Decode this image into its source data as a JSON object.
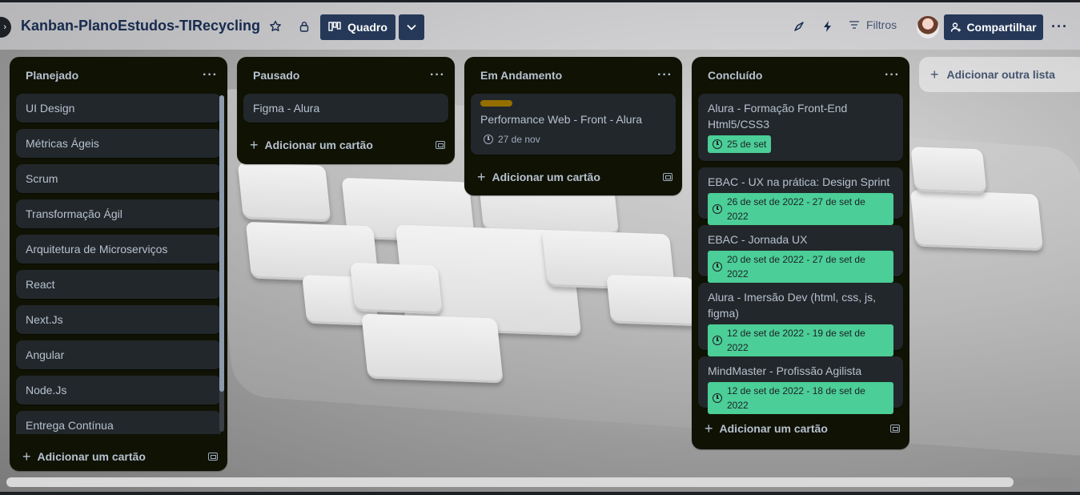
{
  "header": {
    "board_title": "Kanban-PlanoEstudos-TIRecycling",
    "view_label": "Quadro",
    "filters_label": "Filtros",
    "share_label": "Compartilhar"
  },
  "lists": [
    {
      "title": "Planejado",
      "cards": [
        {
          "title": "UI Design"
        },
        {
          "title": "Métricas Ágeis"
        },
        {
          "title": "Scrum"
        },
        {
          "title": "Transformação Ágil"
        },
        {
          "title": "Arquitetura de Microserviços"
        },
        {
          "title": "React"
        },
        {
          "title": "Next.Js"
        },
        {
          "title": "Angular"
        },
        {
          "title": "Node.Js"
        },
        {
          "title": "Entrega Contínua"
        }
      ],
      "add_card_label": "Adicionar um cartão"
    },
    {
      "title": "Pausado",
      "cards": [
        {
          "title": "Figma - Alura"
        }
      ],
      "add_card_label": "Adicionar um cartão"
    },
    {
      "title": "Em Andamento",
      "cards": [
        {
          "title": "Performance Web - Front - Alura",
          "date": "27 de nov",
          "label_color": "#946f00"
        }
      ],
      "add_card_label": "Adicionar um cartão"
    },
    {
      "title": "Concluído",
      "cards": [
        {
          "title": "Alura - Formação Front-End Html5/CSS3",
          "date": "25 de set"
        },
        {
          "title": "EBAC - UX na prática: Design Sprint",
          "date": "26 de set de 2022 - 27 de set de 2022"
        },
        {
          "title": "EBAC - Jornada UX",
          "date": "20 de set de 2022 - 27 de set de 2022"
        },
        {
          "title": "Alura - Imersão Dev (html, css, js, figma)",
          "date": "12 de set de 2022 - 19 de set de 2022"
        },
        {
          "title": "MindMaster - Profissão Agilista",
          "date": "12 de set de 2022 - 18 de set de 2022"
        }
      ],
      "add_card_label": "Adicionar um cartão"
    }
  ],
  "add_list_label": "Adicionar outra lista",
  "colors": {
    "list_bg": "#101204",
    "card_bg": "#22272b",
    "done_badge": "#4bce97",
    "header_button": "#253858"
  }
}
